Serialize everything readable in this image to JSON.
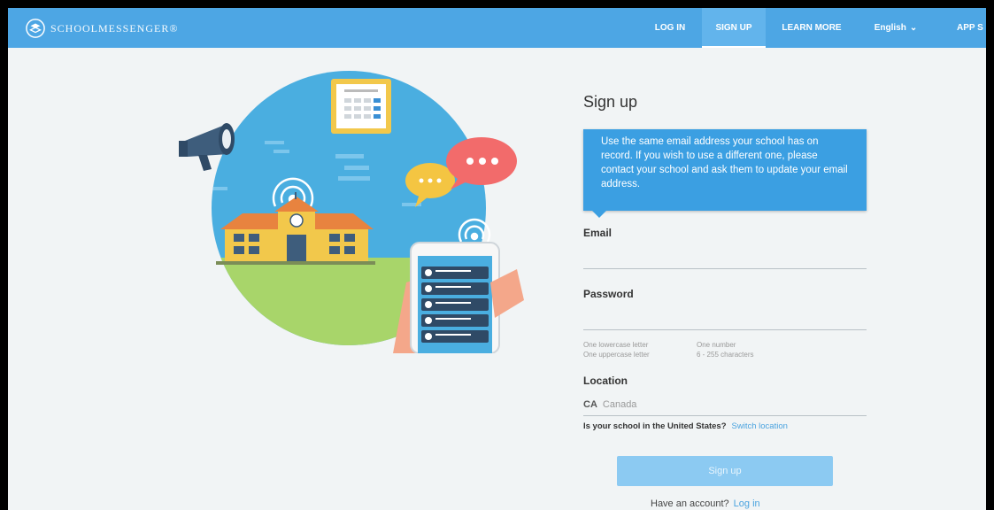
{
  "nav": {
    "brand": "SchoolMessenger®",
    "items": [
      "LOG IN",
      "SIGN UP",
      "LEARN MORE"
    ],
    "language": "English",
    "app_link": "APP S"
  },
  "illustration": {
    "icons": [
      "megaphone-icon",
      "calendar-icon",
      "chat-bubble-icon",
      "school-building-icon",
      "smartphone-icon",
      "wifi-signal-icon"
    ]
  },
  "form": {
    "title": "Sign up",
    "tip": "Use the same email address your school has on record. If you wish to use a different one, please contact your school and ask them to update your email address.",
    "email_label": "Email",
    "email_value": "",
    "password_label": "Password",
    "password_value": "",
    "password_hints": [
      "One lowercase letter",
      "One uppercase letter",
      "One number",
      "6 - 255 characters"
    ],
    "location_label": "Location",
    "location_code": "CA",
    "location_name": "Canada",
    "us_question": "Is your school in the United States?",
    "switch_location": "Switch location",
    "signup_button": "Sign up",
    "have_account": "Have an account?",
    "login_link": "Log in"
  },
  "colors": {
    "nav_bg": "#4da6e4",
    "accent": "#3b9fe2",
    "button_disabled": "#8ccaf2",
    "page_bg": "#f1f4f5"
  }
}
